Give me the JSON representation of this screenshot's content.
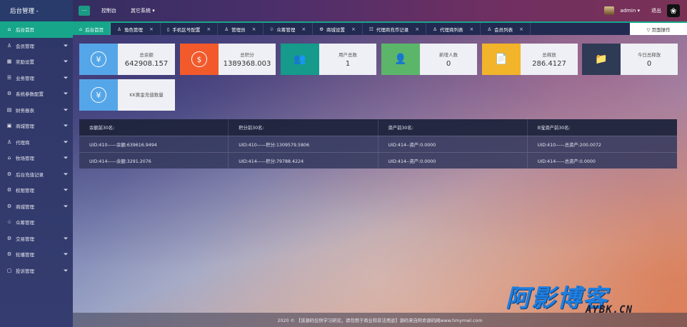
{
  "app": {
    "title": "后台管理 -",
    "menu_toggle": "···"
  },
  "top_nav": [
    "控制台",
    "其它系统 ▾"
  ],
  "top_right": {
    "user": "admin ▾",
    "logout": "退出"
  },
  "sidebar": {
    "items": [
      {
        "label": "后台首页",
        "icon": "home-icon",
        "glyph": "⌂",
        "active": true,
        "has_caret": false
      },
      {
        "label": "会员管理",
        "icon": "user-icon",
        "glyph": "♙",
        "has_caret": true
      },
      {
        "label": "奖励设置",
        "icon": "gift-icon",
        "glyph": "▦",
        "has_caret": true
      },
      {
        "label": "业务管理",
        "icon": "business-icon",
        "glyph": "☰",
        "has_caret": true
      },
      {
        "label": "系统参数配置",
        "icon": "settings-icon",
        "glyph": "⚙",
        "has_caret": true
      },
      {
        "label": "财务报表",
        "icon": "report-icon",
        "glyph": "▤",
        "has_caret": true
      },
      {
        "label": "商城管理",
        "icon": "shop-icon",
        "glyph": "▣",
        "has_caret": true
      },
      {
        "label": "代理商",
        "icon": "agent-icon",
        "glyph": "♙",
        "has_caret": true
      },
      {
        "label": "牧场管理",
        "icon": "farm-icon",
        "glyph": "⌂",
        "has_caret": true
      },
      {
        "label": "后台充值记录",
        "icon": "recharge-icon",
        "glyph": "⚙",
        "has_caret": true
      },
      {
        "label": "权限管理",
        "icon": "permission-icon",
        "glyph": "⚙",
        "has_caret": true
      },
      {
        "label": "商城管理",
        "icon": "mall-icon",
        "glyph": "⚙",
        "has_caret": true
      },
      {
        "label": "众筹管理",
        "icon": "crowdfund-icon",
        "glyph": "♧",
        "has_caret": false
      },
      {
        "label": "交易管理",
        "icon": "trade-icon",
        "glyph": "⚙",
        "has_caret": true
      },
      {
        "label": "轮播管理",
        "icon": "carousel-icon",
        "glyph": "⚙",
        "has_caret": true
      },
      {
        "label": "投诉管理",
        "icon": "complaint-icon",
        "glyph": "▢",
        "has_caret": true
      }
    ]
  },
  "tabs": [
    {
      "label": "后台首页",
      "icon": "home-icon",
      "glyph": "⌂",
      "active": true,
      "closable": false
    },
    {
      "label": "角色管理",
      "icon": "role-icon",
      "glyph": "♙",
      "closable": true
    },
    {
      "label": "手机区号配置",
      "icon": "phone-icon",
      "glyph": "▯",
      "closable": true
    },
    {
      "label": "管理员",
      "icon": "admin-icon",
      "glyph": "♙",
      "closable": true
    },
    {
      "label": "众筹管理",
      "icon": "crowdfund-icon",
      "glyph": "♧",
      "closable": true
    },
    {
      "label": "商城设置",
      "icon": "gear-icon",
      "glyph": "⚙",
      "closable": true
    },
    {
      "label": "代理商充币记录",
      "icon": "list-icon",
      "glyph": "☷",
      "closable": true
    },
    {
      "label": "代理商列表",
      "icon": "agent-list-icon",
      "glyph": "♙",
      "closable": true
    },
    {
      "label": "会员列表",
      "icon": "member-list-icon",
      "glyph": "♙",
      "closable": true
    }
  ],
  "page_ops": "▽ 页面操作",
  "tab_close": "×",
  "cards": [
    {
      "label": "总余额",
      "value": "642908.157",
      "icon": "yen-icon",
      "glyph": "¥",
      "color": "#55a6e8"
    },
    {
      "label": "总积分",
      "value": "1389368.003",
      "icon": "dollar-icon",
      "glyph": "$",
      "color": "#f25a2c"
    },
    {
      "label": "用户总数",
      "value": "1",
      "icon": "users-icon",
      "glyph": "👥",
      "color": "#159a8c"
    },
    {
      "label": "新增人数",
      "value": "0",
      "icon": "person-icon",
      "glyph": "👤",
      "color": "#5bb66a"
    },
    {
      "label": "总释放",
      "value": "286.4127",
      "icon": "document-icon",
      "glyph": "📄",
      "color": "#f2b42a"
    },
    {
      "label": "今日总释放",
      "value": "0",
      "icon": "folder-icon",
      "glyph": "📁",
      "color": "#2f3a55"
    },
    {
      "label": "KK黄金充值数量",
      "value": "",
      "icon": "yen-icon",
      "glyph": "¥",
      "color": "#55a6e8"
    }
  ],
  "table": {
    "headers": [
      "余额前30名:",
      "积分前30名:",
      "资产前30名:",
      "B宝资产前30名:"
    ],
    "rows": [
      [
        "UID:410——余额:639616.9494",
        "UID:410——积分:1309579.5806",
        "UID:414--资产:0.0000",
        "UID:410——总资产:200.0072"
      ],
      [
        "UID:414——余额:3291.2076",
        "UID:414——积分:79788.4224",
        "UID:414--资产:0.0000",
        "UID:414——总资产:0.0000"
      ]
    ]
  },
  "footer": "2020 © 【该源码仅供学习研究，请勿用于商业和非法用途】源码来自阿命源码网www.hmymwl.com",
  "watermark": {
    "main": "阿影博客",
    "sub": "AYBK.CN"
  }
}
